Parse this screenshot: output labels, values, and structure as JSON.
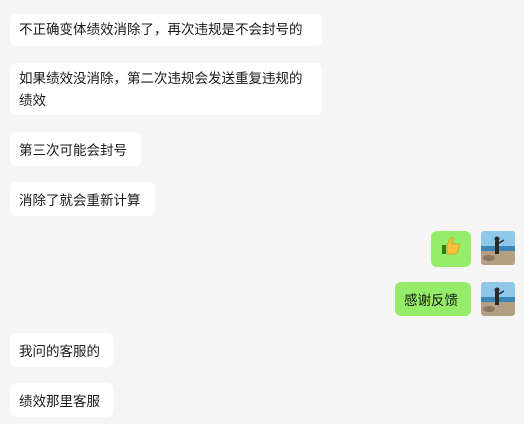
{
  "messages": {
    "m1": {
      "text": "不正确变体绩效消除了，再次违规是不会封号的"
    },
    "m2": {
      "text": "如果绩效没消除，第二次违规会发送重复违规的绩效"
    },
    "m3": {
      "text": "第三次可能会封号"
    },
    "m4": {
      "text": "消除了就会重新计算"
    },
    "m5": {
      "sticker": "thumbs-up-icon"
    },
    "m6": {
      "text": "感谢反馈"
    },
    "m7": {
      "text": "我问的客服的"
    },
    "m8": {
      "text": "绩效那里客服"
    }
  },
  "colors": {
    "background": "#f5f5f5",
    "incoming_bubble": "#ffffff",
    "outgoing_bubble": "#95ec69"
  }
}
